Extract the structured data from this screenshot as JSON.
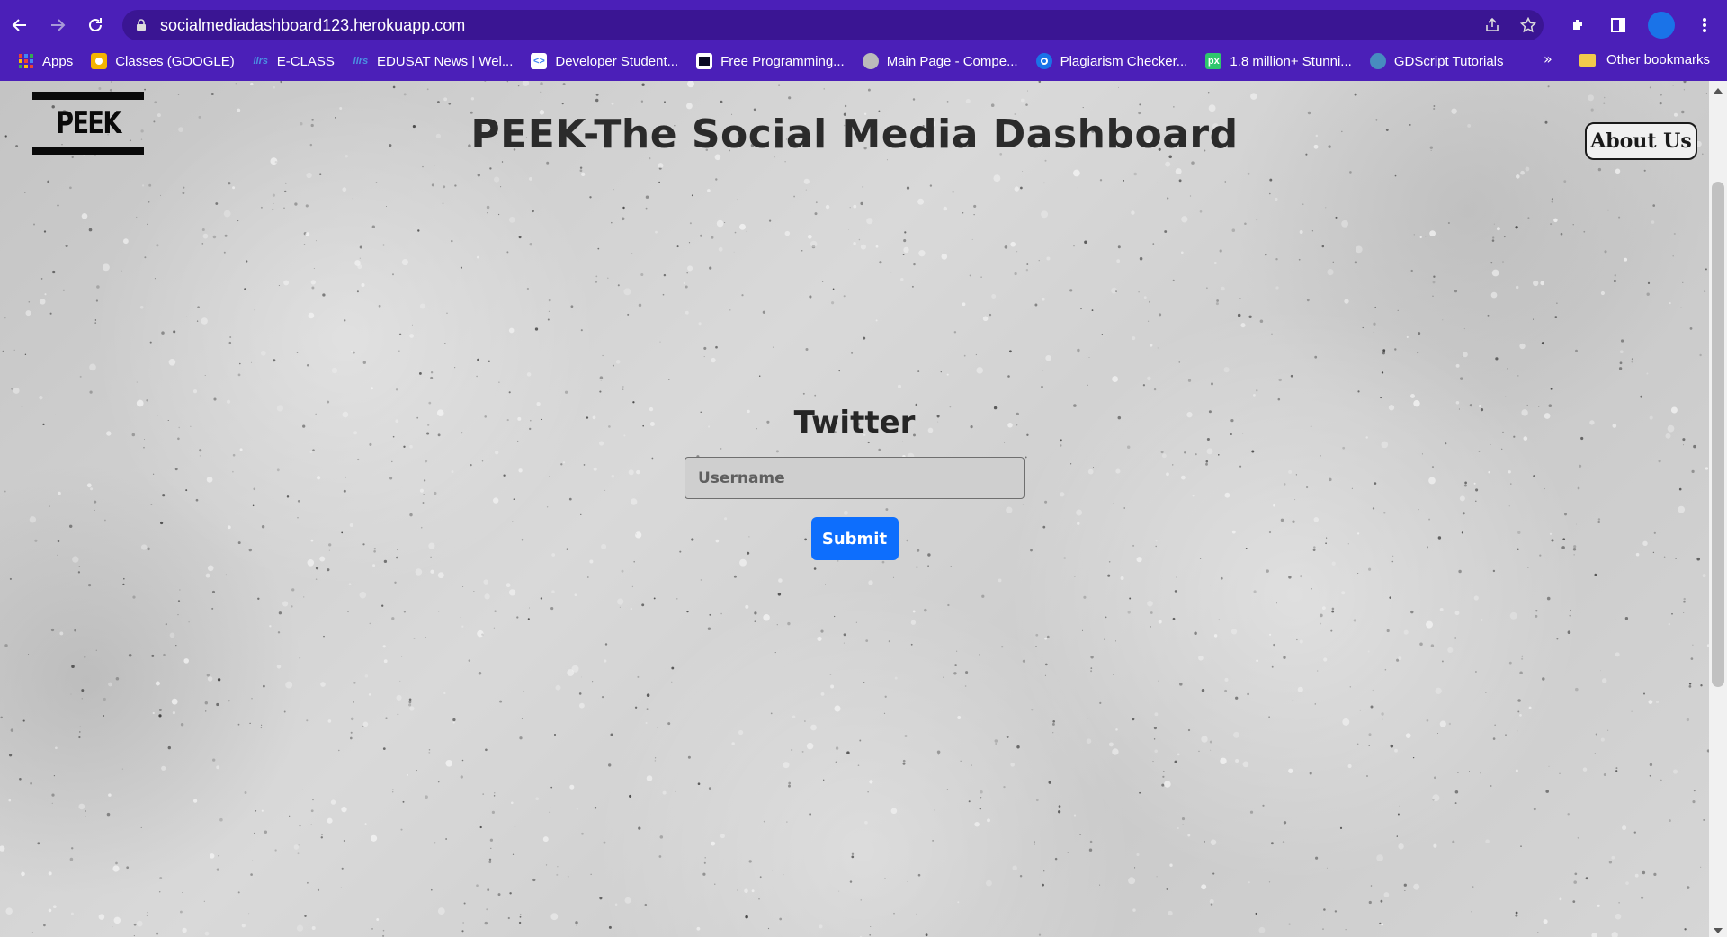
{
  "browser": {
    "url": "socialmediadashboard123.herokuapp.com",
    "bookmarks": [
      {
        "label": "Apps",
        "icon": "apps-grid-icon",
        "color": "#ea4335"
      },
      {
        "label": "Classes (GOOGLE)",
        "icon": "google-classroom-icon",
        "color": "#f4b400"
      },
      {
        "label": "E-CLASS",
        "icon": "iirs-icon",
        "color": "#4a90e2"
      },
      {
        "label": "EDUSAT News | Wel...",
        "icon": "iirs-icon",
        "color": "#4a90e2"
      },
      {
        "label": "Developer Student...",
        "icon": "dsc-icon",
        "color": "#ffffff"
      },
      {
        "label": "Free Programming...",
        "icon": "fcc-icon",
        "color": "#0a0a23"
      },
      {
        "label": "Main Page - Compe...",
        "icon": "wiki-icon",
        "color": "#cccccc"
      },
      {
        "label": "Plagiarism Checker...",
        "icon": "plagiarism-icon",
        "color": "#1a73e8"
      },
      {
        "label": "1.8 million+ Stunni...",
        "icon": "pixabay-icon",
        "color": "#2ec66d"
      },
      {
        "label": "GDScript Tutorials",
        "icon": "gdscript-icon",
        "color": "#478cbf"
      }
    ],
    "more_label": "»",
    "other_bookmarks": "Other bookmarks"
  },
  "page": {
    "logo_text": "PEEK",
    "title": "PEEK-The Social Media Dashboard",
    "about_label": "About Us",
    "form": {
      "heading": "Twitter",
      "username_placeholder": "Username",
      "submit_label": "Submit"
    }
  },
  "colors": {
    "chrome": "#4b1fb8",
    "submit": "#0d6efd"
  }
}
